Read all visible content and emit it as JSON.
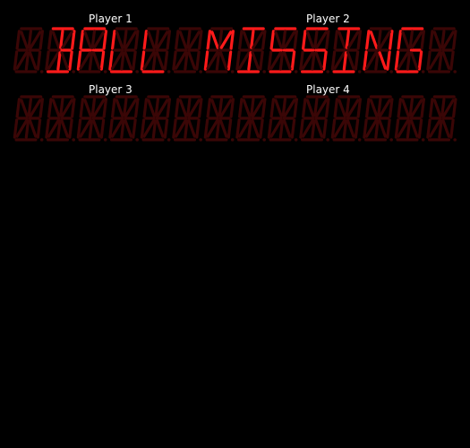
{
  "players": {
    "p1": "Player 1",
    "p2": "Player 2",
    "p3": "Player 3",
    "p4": "Player 4"
  },
  "displays": {
    "top": {
      "text": "BALL MISSING",
      "digits": 14,
      "lit_color": "#ff1a1a",
      "dim_color": "#3a0606"
    },
    "bottom": {
      "text": "",
      "digits": 14,
      "lit_color": "#ff1a1a",
      "dim_color": "#3a0606"
    }
  }
}
